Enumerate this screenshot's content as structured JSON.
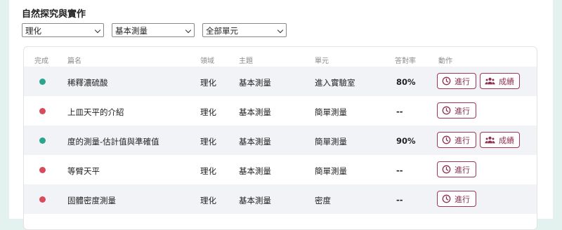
{
  "title": "自然探究與實作",
  "filters": [
    {
      "value": "理化"
    },
    {
      "value": "基本測量"
    },
    {
      "value": "全部單元"
    }
  ],
  "columns": {
    "done": "完成",
    "name": "篇名",
    "field": "領域",
    "topic": "主題",
    "unit": "單元",
    "rate": "答對率",
    "action": "動作"
  },
  "buttons": {
    "go": "進行",
    "score": "成績"
  },
  "colors": {
    "complete": "#2aa58f",
    "incomplete": "#d94a5b",
    "accent": "#9e3756"
  },
  "rows": [
    {
      "done": true,
      "name": "稀釋濃硫酸",
      "field": "理化",
      "topic": "基本測量",
      "unit": "進入實驗室",
      "rate": "80%",
      "has_score": true
    },
    {
      "done": false,
      "name": "上皿天平的介紹",
      "field": "理化",
      "topic": "基本測量",
      "unit": "簡單測量",
      "rate": "--",
      "has_score": false
    },
    {
      "done": true,
      "name": "度的測量-估計值與準確值",
      "field": "理化",
      "topic": "基本測量",
      "unit": "簡單測量",
      "rate": "90%",
      "has_score": true
    },
    {
      "done": false,
      "name": "等臂天平",
      "field": "理化",
      "topic": "基本測量",
      "unit": "簡單測量",
      "rate": "--",
      "has_score": false
    },
    {
      "done": false,
      "name": "固體密度測量",
      "field": "理化",
      "topic": "基本測量",
      "unit": "密度",
      "rate": "--",
      "has_score": false
    }
  ]
}
